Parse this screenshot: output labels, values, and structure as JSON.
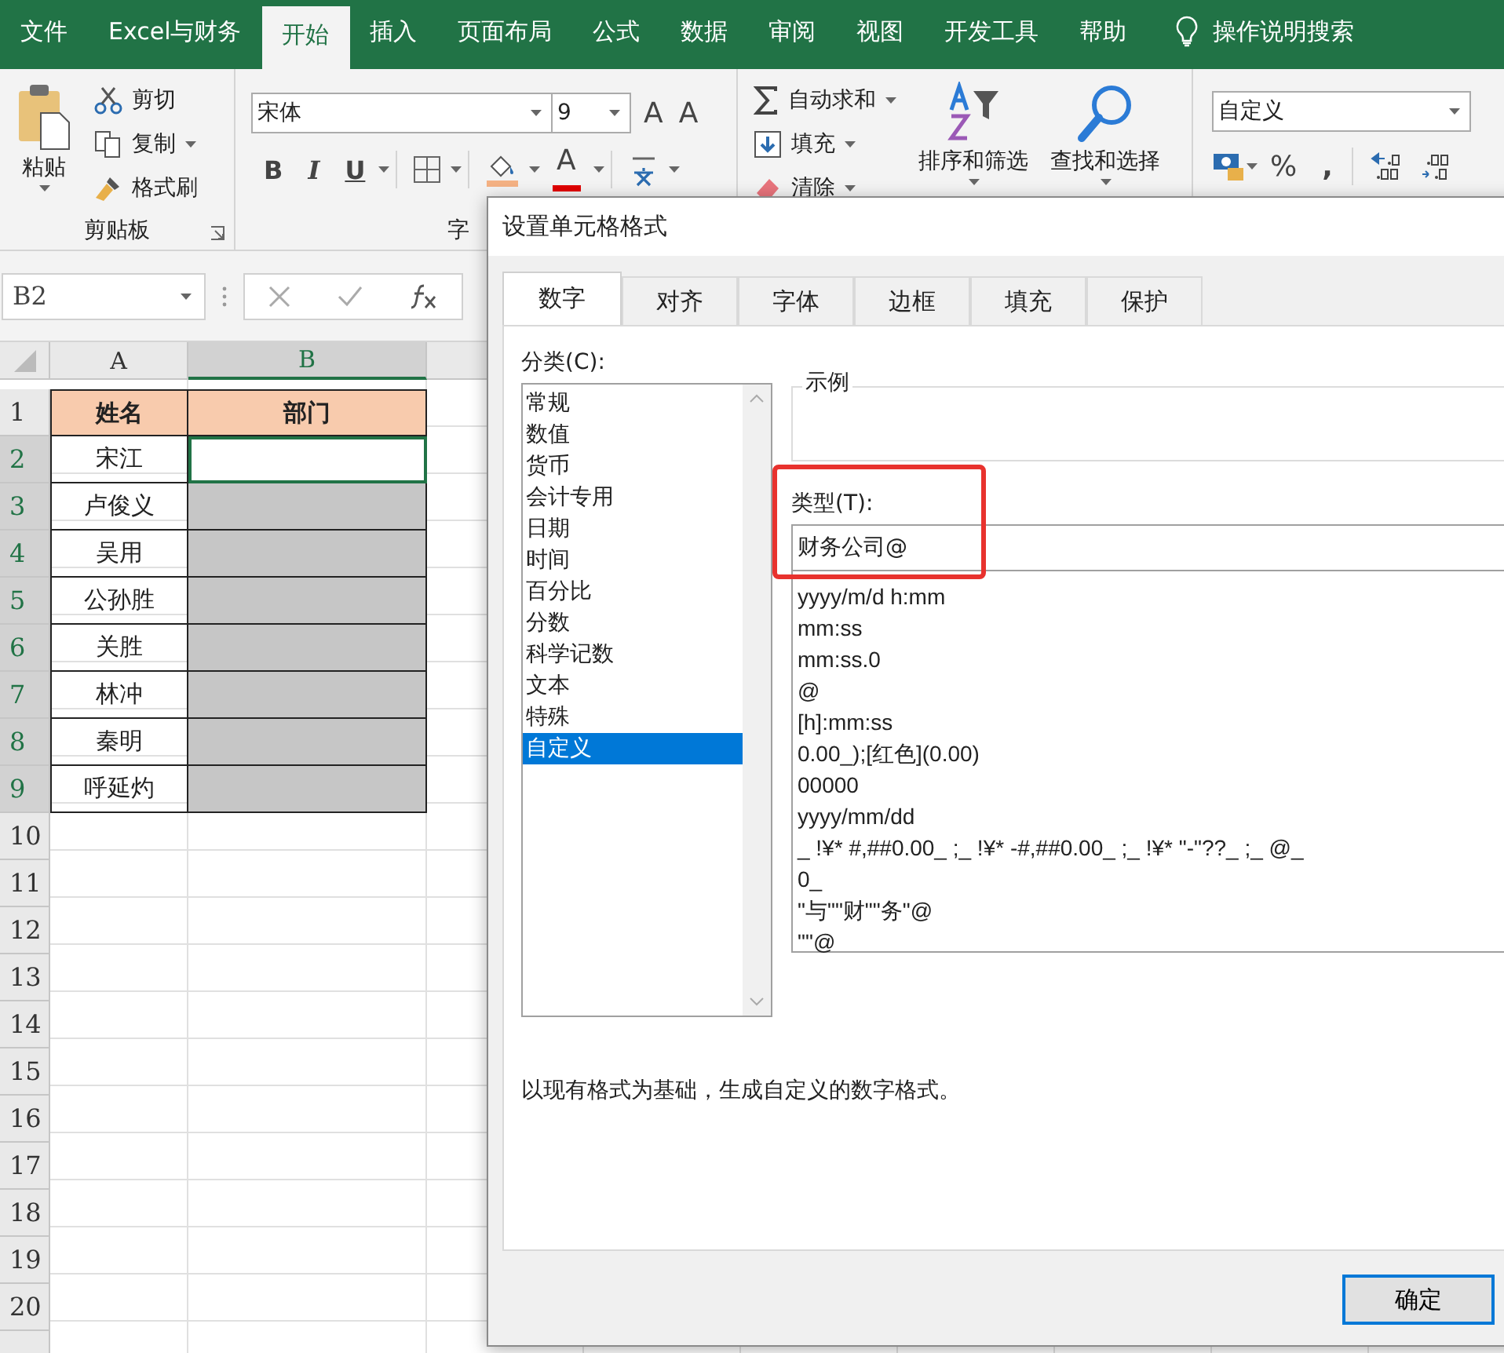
{
  "menu_bar": {
    "tabs": [
      {
        "label": "文件",
        "selected": false
      },
      {
        "label": "Excel与财务",
        "selected": false
      },
      {
        "label": "开始",
        "selected": true
      },
      {
        "label": "插入",
        "selected": false
      },
      {
        "label": "页面布局",
        "selected": false
      },
      {
        "label": "公式",
        "selected": false
      },
      {
        "label": "数据",
        "selected": false
      },
      {
        "label": "审阅",
        "selected": false
      },
      {
        "label": "视图",
        "selected": false
      },
      {
        "label": "开发工具",
        "selected": false
      },
      {
        "label": "帮助",
        "selected": false
      }
    ],
    "search": "操作说明搜索"
  },
  "ribbon": {
    "clipboard": {
      "paste": "粘贴",
      "cut": "剪切",
      "copy": "复制",
      "format_painter": "格式刷",
      "label": "剪贴板"
    },
    "font": {
      "name": "宋体",
      "size": "9",
      "grow": "A",
      "shrink": "A",
      "bold": "B",
      "italic": "I",
      "underline": "U",
      "font_color": "A",
      "label": "字"
    },
    "editing": {
      "autosum": "自动求和",
      "fill": "填充",
      "clear": "清除",
      "sort_filter": "排序和筛选",
      "find_select": "查找和选择"
    },
    "number": {
      "format": "自定义",
      "percent": "%",
      "comma": ","
    }
  },
  "formula_bar": {
    "name_box": "B2"
  },
  "sheet": {
    "columns": [
      {
        "label": "A",
        "selected": false
      },
      {
        "label": "B",
        "selected": true
      }
    ],
    "header_row": {
      "number": "1",
      "name": "姓名",
      "department": "部门"
    },
    "rows": [
      {
        "number": "2",
        "name": "宋江",
        "selected": true,
        "active": true
      },
      {
        "number": "3",
        "name": "卢俊义",
        "selected": true,
        "active": false
      },
      {
        "number": "4",
        "name": "吴用",
        "selected": true,
        "active": false
      },
      {
        "number": "5",
        "name": "公孙胜",
        "selected": true,
        "active": false
      },
      {
        "number": "6",
        "name": "关胜",
        "selected": true,
        "active": false
      },
      {
        "number": "7",
        "name": "林冲",
        "selected": true,
        "active": false
      },
      {
        "number": "8",
        "name": "秦明",
        "selected": true,
        "active": false
      },
      {
        "number": "9",
        "name": "呼延灼",
        "selected": true,
        "active": false
      }
    ],
    "empty_rows": [
      "10",
      "11",
      "12",
      "13",
      "14",
      "15",
      "16",
      "17",
      "18",
      "19",
      "20"
    ]
  },
  "dialog": {
    "title": "设置单元格格式",
    "tabs": [
      {
        "label": "数字",
        "selected": true
      },
      {
        "label": "对齐",
        "selected": false
      },
      {
        "label": "字体",
        "selected": false
      },
      {
        "label": "边框",
        "selected": false
      },
      {
        "label": "填充",
        "selected": false
      },
      {
        "label": "保护",
        "selected": false
      }
    ],
    "category_label": "分类(C):",
    "categories": [
      {
        "label": "常规",
        "selected": false
      },
      {
        "label": "数值",
        "selected": false
      },
      {
        "label": "货币",
        "selected": false
      },
      {
        "label": "会计专用",
        "selected": false
      },
      {
        "label": "日期",
        "selected": false
      },
      {
        "label": "时间",
        "selected": false
      },
      {
        "label": "百分比",
        "selected": false
      },
      {
        "label": "分数",
        "selected": false
      },
      {
        "label": "科学记数",
        "selected": false
      },
      {
        "label": "文本",
        "selected": false
      },
      {
        "label": "特殊",
        "selected": false
      },
      {
        "label": "自定义",
        "selected": true
      }
    ],
    "sample_label": "示例",
    "type_label": "类型(T):",
    "type_value": "财务公司@",
    "formats": [
      "yyyy/m/d h:mm",
      "mm:ss",
      "mm:ss.0",
      "@",
      "[h]:mm:ss",
      "0.00_);[红色](0.00)",
      "00000",
      "yyyy/mm/dd",
      "_ !¥* #,##0.00_ ;_ !¥* -#,##0.00_ ;_ !¥* \"-\"??_ ;_ @_",
      "0_",
      "\"与\"\"财\"\"务\"@",
      "\"\"@"
    ],
    "description": "以现有格式为基础，生成自定义的数字格式。",
    "ok_button": "确定"
  }
}
